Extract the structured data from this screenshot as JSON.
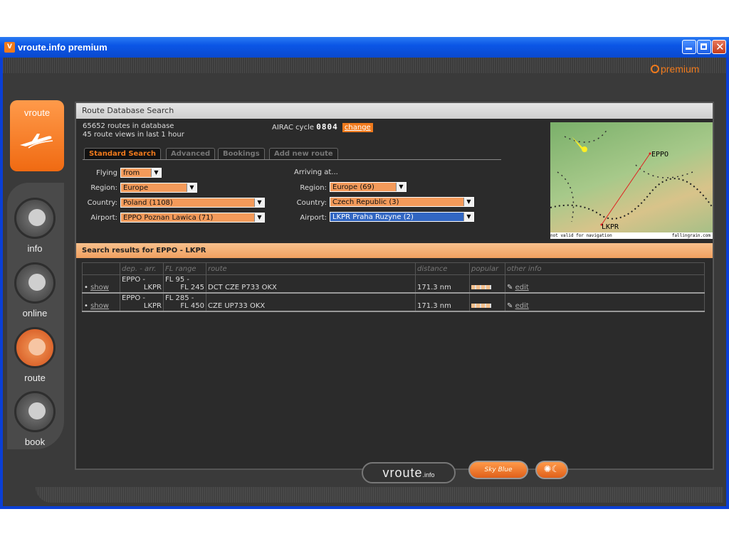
{
  "window": {
    "title": "vroute.info premium",
    "icon_label": "V",
    "accent": "#f07a1c",
    "titlebar_color": "#0b56e6"
  },
  "header": {
    "premium_label": "premium"
  },
  "sidebar": {
    "logo_label": "vroute",
    "items": [
      {
        "label": "info"
      },
      {
        "label": "online"
      },
      {
        "label": "route",
        "active": true
      },
      {
        "label": "book"
      }
    ]
  },
  "panel": {
    "title": "Route Database Search",
    "stats_routes": "65652 routes in database",
    "stats_views": "45 route views in last 1 hour",
    "airac_label": "AIRAC cycle",
    "airac_cycle": "0804",
    "airac_change": "change",
    "tabs": [
      "Standard Search",
      "Advanced",
      "Bookings",
      "Add new route"
    ],
    "departure": {
      "flying_label": "Flying",
      "flying_value": "from",
      "region_label": "Region:",
      "region_value": "Europe",
      "country_label": "Country:",
      "country_value": "Poland (1108)",
      "airport_label": "Airport:",
      "airport_value": "EPPO Poznan Lawica (71)"
    },
    "arrival": {
      "section_label": "Arriving at...",
      "region_label": "Region:",
      "region_value": "Europe (69)",
      "country_label": "Country:",
      "country_value": "Czech Republic (3)",
      "airport_label": "Airport:",
      "airport_value": "LKPR Praha Ruzyne (2)"
    },
    "map": {
      "city_from": "EPPO",
      "city_to": "LKPR",
      "note_left": "not valid for navigation",
      "note_right": "fallingrain.com"
    }
  },
  "results": {
    "title": "Search results for EPPO - LKPR",
    "columns": [
      "",
      "dep. - arr.",
      "FL range",
      "route",
      "distance",
      "popular",
      "other info"
    ],
    "rows": [
      {
        "show": "show",
        "dep": "EPPO -",
        "arr": "LKPR",
        "fl_low": "FL 95 -",
        "fl_high": "FL 245",
        "route": "DCT CZE P733 OKX",
        "distance": "171.3 nm",
        "edit": "edit"
      },
      {
        "show": "show",
        "dep": "EPPO -",
        "arr": "LKPR",
        "fl_low": "FL 285 -",
        "fl_high": "FL 450",
        "route": "CZE UP733 OKX",
        "distance": "171.3 nm",
        "edit": "edit"
      }
    ]
  },
  "footer": {
    "brand": "vroute",
    "brand_suffix": ".info",
    "skin_label": "Sky Blue"
  }
}
